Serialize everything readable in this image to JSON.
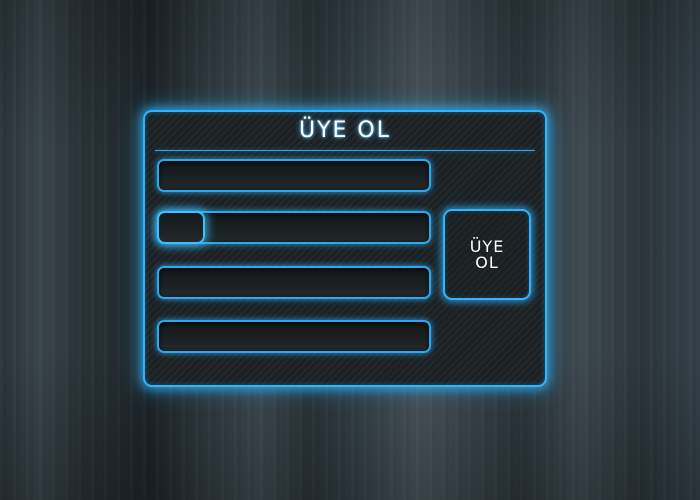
{
  "register_form": {
    "title": "ÜYE OL",
    "submit_label": "ÜYE OL",
    "fields": [
      {
        "value": "",
        "placeholder": ""
      },
      {
        "value": "",
        "placeholder": ""
      },
      {
        "value": "",
        "placeholder": ""
      },
      {
        "value": "",
        "placeholder": ""
      }
    ]
  },
  "colors": {
    "accent_glow": "#2fb4ff",
    "panel_background": "#1b2023",
    "text": "#ffffff"
  }
}
